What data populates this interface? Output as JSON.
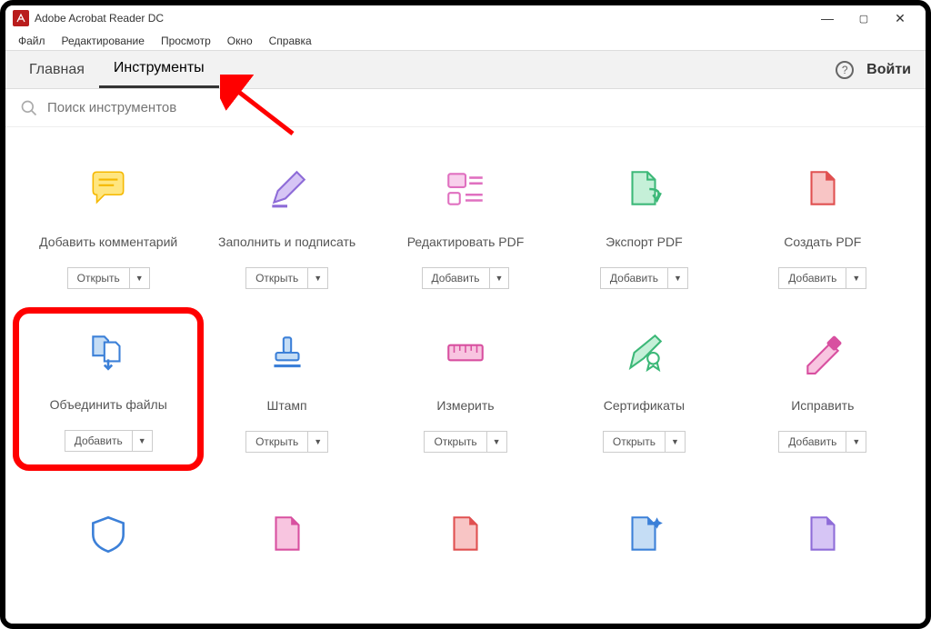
{
  "app": {
    "title": "Adobe Acrobat Reader DC"
  },
  "window_controls": {
    "min": "—",
    "max": "▢",
    "close": "✕"
  },
  "menus": [
    "Файл",
    "Редактирование",
    "Просмотр",
    "Окно",
    "Справка"
  ],
  "tabs": {
    "home": "Главная",
    "tools": "Инструменты"
  },
  "header": {
    "help": "?",
    "signin": "Войти"
  },
  "search": {
    "placeholder": "Поиск инструментов"
  },
  "buttons": {
    "open": "Открыть",
    "add": "Добавить",
    "arrow": "▼"
  },
  "tools": {
    "comment": "Добавить комментарий",
    "fillsign": "Заполнить и подписать",
    "edit": "Редактировать PDF",
    "export": "Экспорт PDF",
    "create": "Создать PDF",
    "combine": "Объединить файлы",
    "stamp": "Штамп",
    "measure": "Измерить",
    "cert": "Сертификаты",
    "redact": "Исправить"
  }
}
